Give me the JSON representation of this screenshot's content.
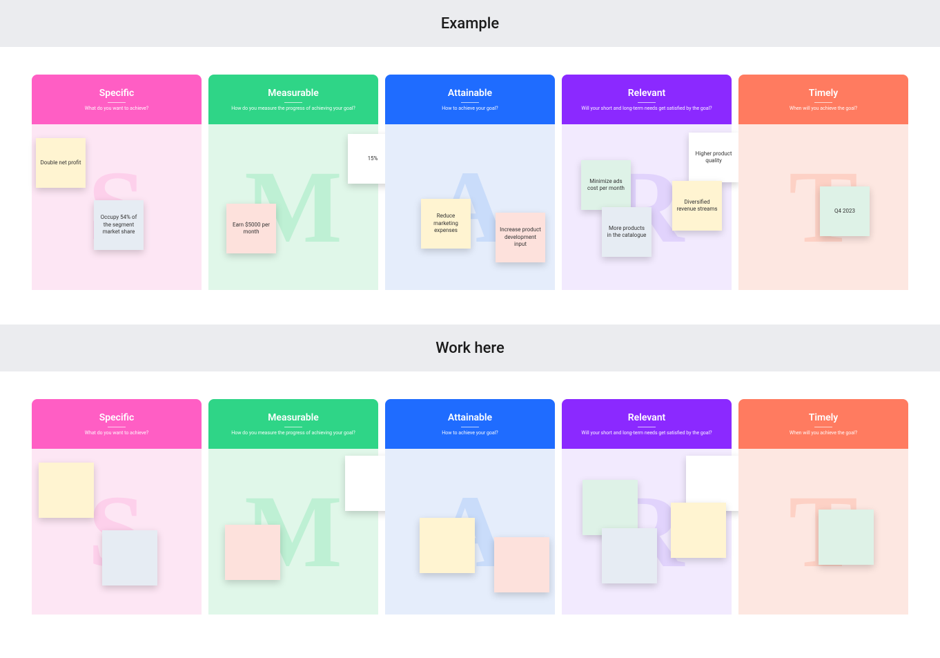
{
  "sections": {
    "example": {
      "title": "Example"
    },
    "work": {
      "title": "Work here"
    }
  },
  "columns": [
    {
      "key": "specific",
      "title": "Specific",
      "subtitle": "What do you want to achieve?",
      "letter": "S"
    },
    {
      "key": "measurable",
      "title": "Measurable",
      "subtitle": "How do you measure the progress of achieving your goal?",
      "letter": "M"
    },
    {
      "key": "attainable",
      "title": "Attainable",
      "subtitle": "How to achieve your goal?",
      "letter": "A"
    },
    {
      "key": "relevant",
      "title": "Relevant",
      "subtitle": "Will your short and long-term needs get satisfied by the goal?",
      "letter": "R"
    },
    {
      "key": "timely",
      "title": "Timely",
      "subtitle": "When will you achieve the goal?",
      "letter": "T"
    }
  ],
  "example_notes": {
    "specific": [
      {
        "text": "Double net profit"
      },
      {
        "text": "Occupy 54% of the segment market share"
      }
    ],
    "measurable": [
      {
        "text": "Earn $5000 per month"
      },
      {
        "text": "15%"
      }
    ],
    "attainable": [
      {
        "text": "Reduce marketing expenses"
      },
      {
        "text": "Increase product development input"
      }
    ],
    "relevant": [
      {
        "text": "Minimize ads cost per month"
      },
      {
        "text": "More products in the catalogue"
      },
      {
        "text": "Higher product quality"
      },
      {
        "text": "Diversified revenue streams"
      }
    ],
    "timely": [
      {
        "text": "Q4 2023"
      }
    ]
  }
}
